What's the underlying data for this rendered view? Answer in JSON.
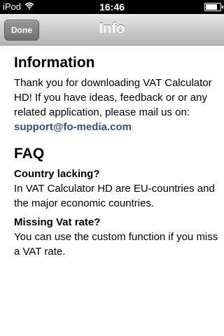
{
  "status_bar": {
    "carrier": "iPod",
    "time": "16:46",
    "battery_level_percent": 80
  },
  "nav": {
    "done_label": "Done",
    "title": "Info"
  },
  "information": {
    "heading": "Information",
    "body": "Thank you for downloading VAT Calculator HD! If you have ideas, feedback or or any related application, please mail us on:",
    "email": "support@fo-media.com"
  },
  "faq": {
    "heading": "FAQ",
    "items": [
      {
        "question": "Country lacking?",
        "answer": "In VAT Calculator HD are EU-countries and the major economic countries."
      },
      {
        "question": "Missing Vat rate?",
        "answer": "You can use the custom function if you miss a VAT rate."
      }
    ]
  }
}
